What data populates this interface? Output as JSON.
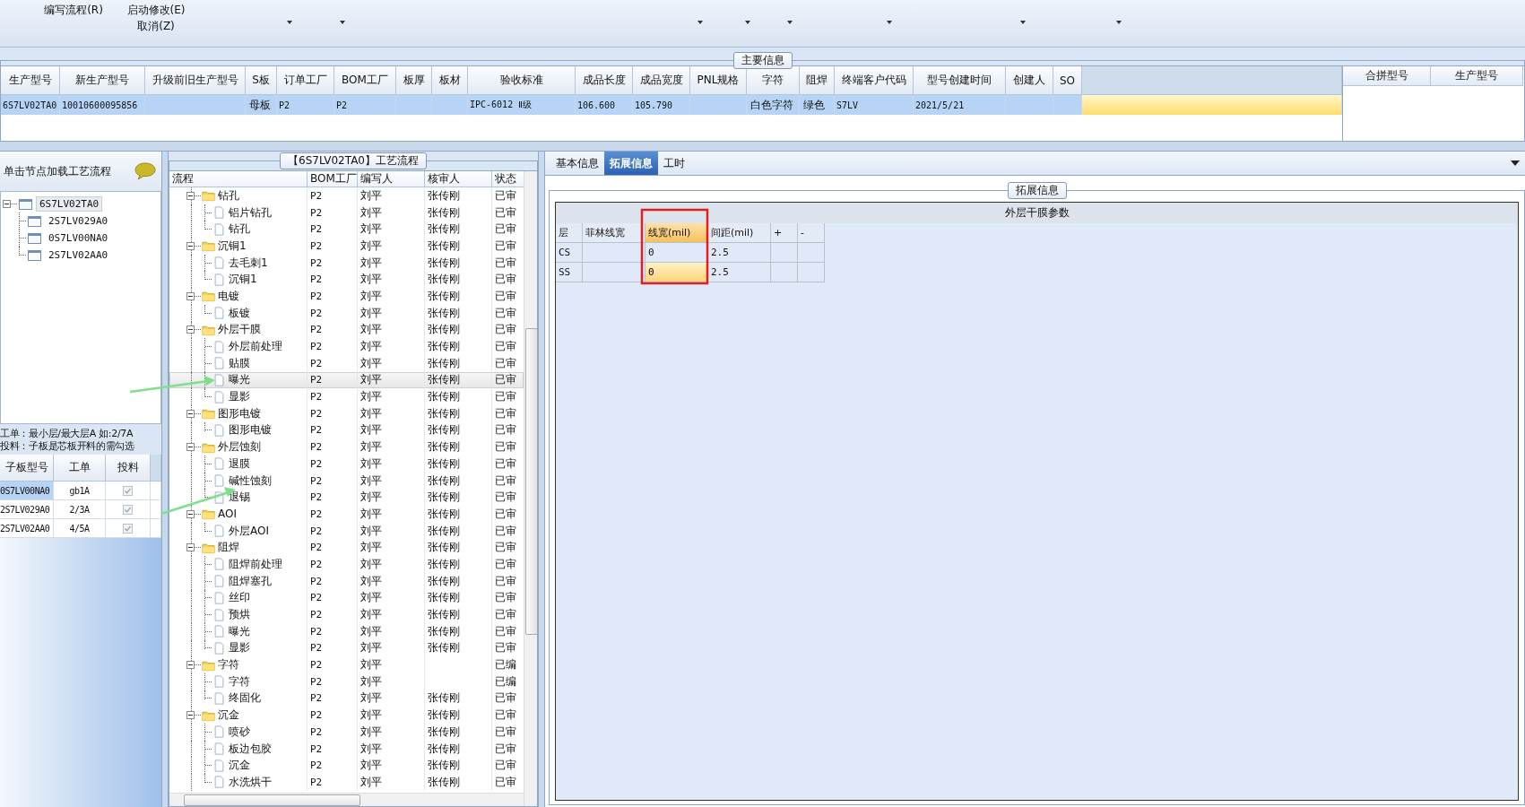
{
  "toolbar": {
    "items": [
      {
        "label": "编写流程(R)"
      },
      {
        "label": "启动修改(E)"
      },
      {
        "label": "取消(Z)"
      }
    ]
  },
  "main_info": {
    "title": "主要信息",
    "columns": [
      "生产型号",
      "新生产型号",
      "升级前旧生产型号",
      "S板",
      "订单工厂",
      "BOM工厂",
      "板厚",
      "板材",
      "验收标准",
      "成品长度",
      "成品宽度",
      "PNL规格",
      "字符",
      "阻焊",
      "终端客户代码",
      "型号创建时间",
      "创建人",
      "SO"
    ],
    "rows": [
      {
        "selected": true,
        "cells": [
          "6S7LV02TA0",
          "10010600095856",
          "",
          "母板",
          "P2",
          "P2",
          "",
          "",
          "IPC-6012 Ⅱ级",
          "106.600",
          "105.790",
          "",
          "白色字符",
          "绿色",
          "S7LV",
          "2021/5/21",
          "",
          ""
        ]
      }
    ]
  },
  "merge_table": {
    "columns": [
      "合拼型号",
      "生产型号"
    ]
  },
  "node_panel": {
    "hint": "单击节点加载工艺流程",
    "tree": [
      {
        "label": "6S7LV02TA0",
        "selected": true,
        "children": [
          {
            "label": "2S7LV029A0",
            "selected": false
          },
          {
            "label": "0S7LV00NA0",
            "selected": false
          },
          {
            "label": "2S7LV02AA0",
            "selected": false
          }
        ]
      }
    ],
    "notes": [
      "工单：最小层/最大层A 如:2/7A",
      "投料：子板是芯板开料的需勾选"
    ],
    "sub_table": {
      "columns": [
        "子板型号",
        "工单",
        "投料"
      ],
      "rows": [
        {
          "cells": [
            "0S7LV00NA0",
            "gb1A"
          ],
          "checked": true,
          "selected": true
        },
        {
          "cells": [
            "2S7LV029A0",
            "2/3A"
          ],
          "checked": true,
          "selected": false
        },
        {
          "cells": [
            "2S7LV02AA0",
            "4/5A"
          ],
          "checked": true,
          "selected": false
        }
      ]
    }
  },
  "process": {
    "title": "【6S7LV02TA0】工艺流程",
    "columns": [
      "流程",
      "BOM工厂",
      "编写人",
      "核审人",
      "状态"
    ],
    "rows": [
      {
        "name": "钻孔",
        "bom": "P2",
        "writer": "刘平",
        "reviewer": "张传刚",
        "status": "已审",
        "selected": false,
        "children": [
          {
            "name": "铝片钻孔",
            "bom": "P2",
            "writer": "刘平",
            "reviewer": "张传刚",
            "status": "已审",
            "selected": false
          },
          {
            "name": "钻孔",
            "bom": "P2",
            "writer": "刘平",
            "reviewer": "张传刚",
            "status": "已审",
            "selected": false
          }
        ]
      },
      {
        "name": "沉铜1",
        "bom": "P2",
        "writer": "刘平",
        "reviewer": "张传刚",
        "status": "已审",
        "selected": false,
        "children": [
          {
            "name": "去毛刺1",
            "bom": "P2",
            "writer": "刘平",
            "reviewer": "张传刚",
            "status": "已审",
            "selected": false
          },
          {
            "name": "沉铜1",
            "bom": "P2",
            "writer": "刘平",
            "reviewer": "张传刚",
            "status": "已审",
            "selected": false
          }
        ]
      },
      {
        "name": "电镀",
        "bom": "P2",
        "writer": "刘平",
        "reviewer": "张传刚",
        "status": "已审",
        "selected": false,
        "children": [
          {
            "name": "板镀",
            "bom": "P2",
            "writer": "刘平",
            "reviewer": "张传刚",
            "status": "已审",
            "selected": false
          }
        ]
      },
      {
        "name": "外层干膜",
        "bom": "P2",
        "writer": "刘平",
        "reviewer": "张传刚",
        "status": "已审",
        "selected": false,
        "children": [
          {
            "name": "外层前处理",
            "bom": "P2",
            "writer": "刘平",
            "reviewer": "张传刚",
            "status": "已审",
            "selected": false
          },
          {
            "name": "贴膜",
            "bom": "P2",
            "writer": "刘平",
            "reviewer": "张传刚",
            "status": "已审",
            "selected": false
          },
          {
            "name": "曝光",
            "bom": "P2",
            "writer": "刘平",
            "reviewer": "张传刚",
            "status": "已审",
            "selected": true
          },
          {
            "name": "显影",
            "bom": "P2",
            "writer": "刘平",
            "reviewer": "张传刚",
            "status": "已审",
            "selected": false
          }
        ]
      },
      {
        "name": "图形电镀",
        "bom": "P2",
        "writer": "刘平",
        "reviewer": "张传刚",
        "status": "已审",
        "selected": false,
        "children": [
          {
            "name": "图形电镀",
            "bom": "P2",
            "writer": "刘平",
            "reviewer": "张传刚",
            "status": "已审",
            "selected": false
          }
        ]
      },
      {
        "name": "外层蚀刻",
        "bom": "P2",
        "writer": "刘平",
        "reviewer": "张传刚",
        "status": "已审",
        "selected": false,
        "children": [
          {
            "name": "退膜",
            "bom": "P2",
            "writer": "刘平",
            "reviewer": "张传刚",
            "status": "已审",
            "selected": false
          },
          {
            "name": "碱性蚀刻",
            "bom": "P2",
            "writer": "刘平",
            "reviewer": "张传刚",
            "status": "已审",
            "selected": false
          },
          {
            "name": "退锡",
            "bom": "P2",
            "writer": "刘平",
            "reviewer": "张传刚",
            "status": "已审",
            "selected": false
          }
        ]
      },
      {
        "name": "AOI",
        "bom": "P2",
        "writer": "刘平",
        "reviewer": "张传刚",
        "status": "已审",
        "selected": false,
        "children": [
          {
            "name": "外层AOI",
            "bom": "P2",
            "writer": "刘平",
            "reviewer": "张传刚",
            "status": "已审",
            "selected": false
          }
        ]
      },
      {
        "name": "阻焊",
        "bom": "P2",
        "writer": "刘平",
        "reviewer": "张传刚",
        "status": "已审",
        "selected": false,
        "children": [
          {
            "name": "阻焊前处理",
            "bom": "P2",
            "writer": "刘平",
            "reviewer": "张传刚",
            "status": "已审",
            "selected": false
          },
          {
            "name": "阻焊塞孔",
            "bom": "P2",
            "writer": "刘平",
            "reviewer": "张传刚",
            "status": "已审",
            "selected": false
          },
          {
            "name": "丝印",
            "bom": "P2",
            "writer": "刘平",
            "reviewer": "张传刚",
            "status": "已审",
            "selected": false
          },
          {
            "name": "预烘",
            "bom": "P2",
            "writer": "刘平",
            "reviewer": "张传刚",
            "status": "已审",
            "selected": false
          },
          {
            "name": "曝光",
            "bom": "P2",
            "writer": "刘平",
            "reviewer": "张传刚",
            "status": "已审",
            "selected": false
          },
          {
            "name": "显影",
            "bom": "P2",
            "writer": "刘平",
            "reviewer": "张传刚",
            "status": "已审",
            "selected": false
          }
        ]
      },
      {
        "name": "字符",
        "bom": "P2",
        "writer": "刘平",
        "status": "已编",
        "selected": false,
        "children": [
          {
            "name": "字符",
            "bom": "P2",
            "writer": "刘平",
            "status": "已编",
            "selected": false
          },
          {
            "name": "终固化",
            "bom": "P2",
            "writer": "刘平",
            "reviewer": "张传刚",
            "status": "已审",
            "selected": false
          }
        ]
      },
      {
        "name": "沉金",
        "bom": "P2",
        "writer": "刘平",
        "reviewer": "张传刚",
        "status": "已审",
        "selected": false,
        "children": [
          {
            "name": "喷砂",
            "bom": "P2",
            "writer": "刘平",
            "reviewer": "张传刚",
            "status": "已审",
            "selected": false
          },
          {
            "name": "板边包胶",
            "bom": "P2",
            "writer": "刘平",
            "reviewer": "张传刚",
            "status": "已审",
            "selected": false
          },
          {
            "name": "沉金",
            "bom": "P2",
            "writer": "刘平",
            "reviewer": "张传刚",
            "status": "已审",
            "selected": false
          },
          {
            "name": "水洗烘干",
            "bom": "P2",
            "writer": "刘平",
            "reviewer": "张传刚",
            "status": "已审",
            "selected": false
          }
        ]
      }
    ]
  },
  "tabs": [
    {
      "label": "基本信息",
      "selected": false
    },
    {
      "label": "拓展信息",
      "selected": true
    },
    {
      "label": "工时",
      "selected": false
    }
  ],
  "ext": {
    "title": "拓展信息",
    "table": {
      "title": "外层干膜参数",
      "columns": [
        {
          "label": "层",
          "selected": false
        },
        {
          "label": "菲林线宽",
          "selected": false
        },
        {
          "label": "线宽(mil)",
          "selected": true
        },
        {
          "label": "间距(mil)",
          "selected": false
        },
        {
          "label": "+",
          "selected": false
        },
        {
          "label": "-",
          "selected": false
        }
      ],
      "rows": [
        {
          "cells": [
            "CS",
            "",
            "0",
            "2.5",
            "",
            ""
          ],
          "selected": false
        },
        {
          "cells": [
            "SS",
            "",
            "0",
            "2.5",
            "",
            ""
          ],
          "selected": true
        }
      ]
    }
  }
}
